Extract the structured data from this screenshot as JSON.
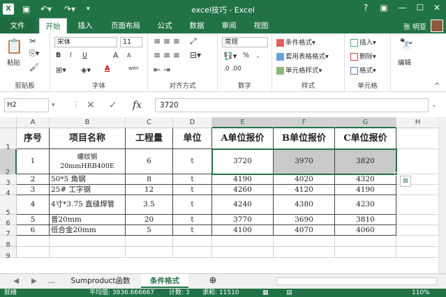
{
  "window": {
    "title": "excel技巧 - Excel",
    "help": "?",
    "user": "张 明亚"
  },
  "tabs": [
    "文件",
    "开始",
    "插入",
    "页面布局",
    "公式",
    "数据",
    "审阅",
    "视图"
  ],
  "ribbon": {
    "clipboard": {
      "paste": "粘贴",
      "label": "剪贴板"
    },
    "font": {
      "name": "宋体",
      "size": "11",
      "bold": "B",
      "italic": "I",
      "underline": "U",
      "grow": "A",
      "shrink": "A",
      "color": "A",
      "wen": "wén",
      "label": "字体"
    },
    "align": {
      "label": "对齐方式"
    },
    "number": {
      "format": "常规",
      "percent": "%",
      "comma": ",",
      "label": "数字"
    },
    "styles": {
      "cond": "条件格式",
      "table": "套用表格格式",
      "cell": "单元格样式",
      "label": "样式"
    },
    "cells": {
      "insert": "插入",
      "delete": "删除",
      "format": "格式",
      "label": "单元格"
    },
    "edit": {
      "label": "编辑"
    }
  },
  "formula_bar": {
    "name_box": "H2",
    "fx": "fx",
    "value": "3720"
  },
  "columns": [
    "A",
    "B",
    "C",
    "D",
    "E",
    "F",
    "G",
    "H"
  ],
  "rows": [
    "1",
    "2",
    "3",
    "4",
    "5",
    "6",
    "7",
    "8",
    "9"
  ],
  "table": {
    "headers": [
      "序号",
      "项目名称",
      "工程量",
      "单位",
      "A单位报价",
      "B单位报价",
      "C单位报价"
    ],
    "rows": [
      [
        "1",
        "螺纹钢\n20mmHRB400E",
        "6",
        "t",
        "3720",
        "3970",
        "3820"
      ],
      [
        "2",
        "50*5 角钢",
        "8",
        "t",
        "4190",
        "4020",
        "4320"
      ],
      [
        "3",
        "25# 工字钢",
        "12",
        "t",
        "4260",
        "4120",
        "4190"
      ],
      [
        "4",
        "4寸*3.75 直缝焊管",
        "3.5",
        "t",
        "4240",
        "4380",
        "4230"
      ],
      [
        "5",
        "普20mm",
        "20",
        "t",
        "3770",
        "3690",
        "3810"
      ],
      [
        "6",
        "低合金20mm",
        "5",
        "t",
        "4100",
        "4070",
        "4060"
      ]
    ]
  },
  "sheets": {
    "more": "...",
    "tabs": [
      "Sumproduct函数",
      "条件格式"
    ],
    "add": "⊕"
  },
  "status": {
    "ready": "就绪",
    "avg": "平均值: 3836.666667",
    "count": "计数: 3",
    "sum": "求和: 11510",
    "zoom": "110%"
  },
  "colors": {
    "accent": "#217346",
    "highlight": "#c9c9c9"
  }
}
